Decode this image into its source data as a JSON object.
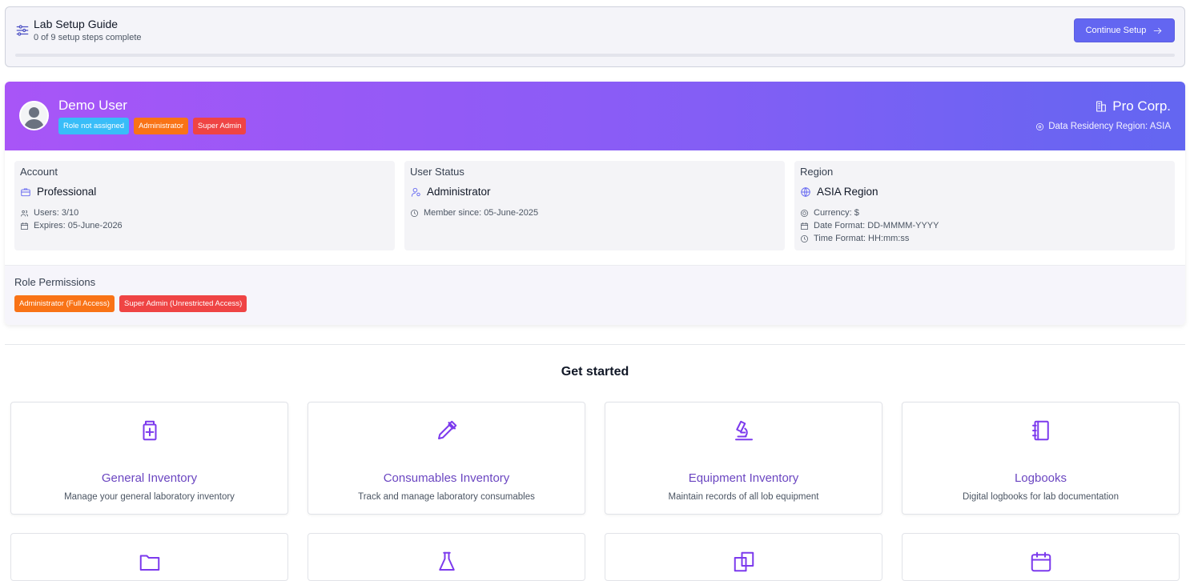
{
  "setup": {
    "title": "Lab Setup Guide",
    "subtitle": "0 of 9 setup steps complete",
    "button_label": "Continue Setup",
    "progress": 0
  },
  "profile": {
    "name": "Demo User",
    "badges": [
      {
        "label": "Role not assigned",
        "color": "#38bdf8"
      },
      {
        "label": "Administrator",
        "color": "#f97316"
      },
      {
        "label": "Super Admin",
        "color": "#ef4444"
      }
    ],
    "org": "Pro Corp.",
    "residency": "Data Residency Region: ASIA"
  },
  "cards": {
    "account": {
      "title": "Account",
      "main": "Professional",
      "lines": [
        "Users: 3/10",
        "Expires: 05-June-2026"
      ]
    },
    "status": {
      "title": "User Status",
      "main": "Administrator",
      "lines": [
        "Member since: 05-June-2025"
      ]
    },
    "region": {
      "title": "Region",
      "main": "ASIA Region",
      "lines": [
        "Currency: $",
        "Date Format: DD-MMMM-YYYY",
        "Time Format: HH:mm:ss"
      ]
    }
  },
  "permissions": {
    "title": "Role Permissions",
    "badges": [
      {
        "label": "Administrator (Full Access)",
        "color": "#f97316"
      },
      {
        "label": "Super Admin (Unrestricted Access)",
        "color": "#ef4444"
      }
    ]
  },
  "get_started": {
    "heading": "Get started",
    "tiles": [
      {
        "title": "General Inventory",
        "desc": "Manage your general laboratory inventory",
        "icon": "bottle-plus-icon"
      },
      {
        "title": "Consumables Inventory",
        "desc": "Track and manage laboratory consumables",
        "icon": "pipette-icon"
      },
      {
        "title": "Equipment Inventory",
        "desc": "Maintain records of all lob equipment",
        "icon": "microscope-icon"
      },
      {
        "title": "Logbooks",
        "desc": "Digital logbooks for lab documentation",
        "icon": "notebook-icon"
      }
    ],
    "row2_icons": [
      "folder-icon",
      "flask-icon",
      "documents-icon",
      "calendar-icon"
    ]
  },
  "colors": {
    "accent": "#6366f1",
    "tile_title": "#6b46c1",
    "banner_start": "#a855f7",
    "banner_end": "#6366f1"
  }
}
